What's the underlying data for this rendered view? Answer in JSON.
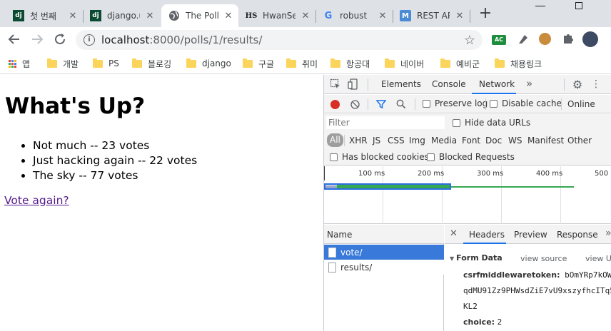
{
  "tabs": [
    {
      "icon": "django-icon",
      "favicon_text": "dj",
      "label": "첫 번째",
      "active": false
    },
    {
      "icon": "django-icon",
      "favicon_text": "dj",
      "label": "django.u",
      "active": false
    },
    {
      "icon": "globe-icon",
      "favicon_text": "",
      "label": "The Poll",
      "active": true
    },
    {
      "icon": "hs-icon",
      "favicon_text": "HS",
      "label": "HwanSe",
      "active": false
    },
    {
      "icon": "google-icon",
      "favicon_text": "G",
      "label": "robust",
      "active": false
    },
    {
      "icon": "m-icon",
      "favicon_text": "M",
      "label": "REST AP",
      "active": false
    }
  ],
  "toolbar": {
    "url_host": "localhost",
    "url_rest": ":8000/polls/1/results/",
    "extension_badge": "AC"
  },
  "bookmarks": [
    {
      "label": "앱",
      "type": "apps"
    },
    {
      "label": "개발",
      "type": "folder"
    },
    {
      "label": "PS",
      "type": "folder"
    },
    {
      "label": "블로깅",
      "type": "folder"
    },
    {
      "label": "django",
      "type": "folder"
    },
    {
      "label": "구글",
      "type": "folder"
    },
    {
      "label": "취미",
      "type": "folder"
    },
    {
      "label": "항공대",
      "type": "folder"
    },
    {
      "label": "네이버",
      "type": "folder"
    },
    {
      "label": "예비군",
      "type": "folder"
    },
    {
      "label": "채용링크",
      "type": "folder"
    }
  ],
  "page": {
    "title": "What's Up?",
    "results": [
      "Not much -- 23 votes",
      "Just hacking again -- 22 votes",
      "The sky -- 77 votes"
    ],
    "vote_again": "Vote again?"
  },
  "devtools": {
    "panels": [
      "Elements",
      "Console",
      "Network"
    ],
    "active_panel": "Network",
    "more": "»",
    "preserve_log": "Preserve log",
    "disable_cache": "Disable cache",
    "throttle": "Online",
    "filter_placeholder": "Filter",
    "hide_data_urls": "Hide data URLs",
    "types": [
      "All",
      "XHR",
      "JS",
      "CSS",
      "Img",
      "Media",
      "Font",
      "Doc",
      "WS",
      "Manifest",
      "Other"
    ],
    "has_blocked_cookies": "Has blocked cookies",
    "blocked_requests": "Blocked Requests",
    "timeline_ticks": [
      "100 ms",
      "200 ms",
      "300 ms",
      "400 ms",
      "500 n"
    ],
    "name_header": "Name",
    "requests": [
      "vote/",
      "results/"
    ],
    "detail_tabs": [
      "Headers",
      "Preview",
      "Response"
    ],
    "detail_more": "»",
    "form_data_title": "Form Data",
    "view_source": "view source",
    "view_url": "view U",
    "csrf_key": "csrfmiddlewaretoken:",
    "csrf_line1": "bOmYRp7kOWg0",
    "csrf_line2": "qdMU91Zz9PHWsdZiE7vU9xszyfhcITq5",
    "csrf_line3": "KL2",
    "choice_key": "choice:",
    "choice_val": "2"
  },
  "colors": {
    "tabstrip": "#dee1e6",
    "accent_blue": "#1a73e8",
    "link_purple": "#551a8b",
    "record_red": "#d93025",
    "selected_row": "#3879d9",
    "timeline_green": "#34a853",
    "timeline_blue": "#2c6ee0"
  }
}
